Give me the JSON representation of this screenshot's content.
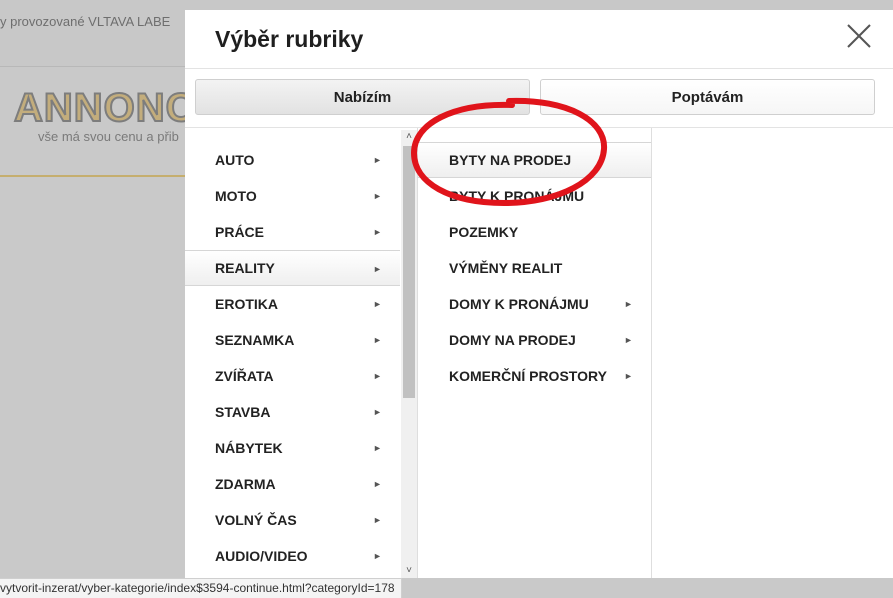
{
  "background": {
    "topbar_text": "y provozované VLTAVA LABE",
    "logo_text": "ANNONCE",
    "slogan": "vše má svou cenu a přib"
  },
  "modal": {
    "title": "Výběr rubriky",
    "close_icon": "close-x-icon",
    "tabs": [
      {
        "label": "Nabízím",
        "active": true
      },
      {
        "label": "Poptávám",
        "active": false
      }
    ],
    "categories": [
      {
        "label": "AUTO"
      },
      {
        "label": "MOTO"
      },
      {
        "label": "PRÁCE"
      },
      {
        "label": "REALITY",
        "selected": true
      },
      {
        "label": "EROTIKA"
      },
      {
        "label": "SEZNAMKA"
      },
      {
        "label": "ZVÍŘATA"
      },
      {
        "label": "STAVBA"
      },
      {
        "label": "NÁBYTEK"
      },
      {
        "label": "ZDARMA"
      },
      {
        "label": "VOLNÝ ČAS"
      },
      {
        "label": "AUDIO/VIDEO"
      }
    ],
    "subcategories": [
      {
        "label": "BYTY NA PRODEJ",
        "selected": true,
        "has_children": false
      },
      {
        "label": "BYTY K PRONÁJMU",
        "has_children": false
      },
      {
        "label": "POZEMKY",
        "has_children": false
      },
      {
        "label": "VÝMĚNY REALIT",
        "has_children": false
      },
      {
        "label": "DOMY K PRONÁJMU",
        "has_children": true
      },
      {
        "label": "DOMY NA PRODEJ",
        "has_children": true
      },
      {
        "label": "KOMERČNÍ PROSTORY",
        "has_children": true
      }
    ],
    "arrow_glyph": "►",
    "scroll_up_glyph": "˄",
    "scroll_down_glyph": "˅"
  },
  "status_url": "vytvorit-inzerat/vyber-kategorie/index$3594-continue.html?categoryId=178",
  "colors": {
    "annotation_red": "#e0141b",
    "overlay_gray": "#c9c9c9",
    "logo_gold": "#c3ad7c"
  }
}
